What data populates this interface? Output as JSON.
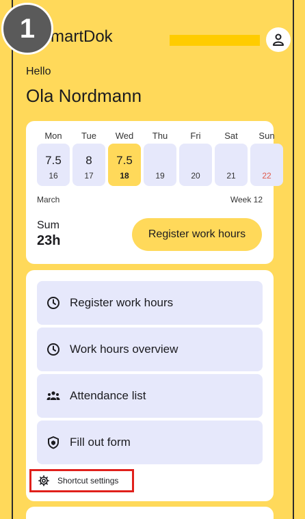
{
  "step_badge": "1",
  "app": {
    "title": "SmartDok",
    "title_visible": "martDok"
  },
  "greeting": {
    "hello": "Hello",
    "name": "Ola Nordmann"
  },
  "week": {
    "days": [
      {
        "name": "Mon",
        "hours": "7.5",
        "date": "16"
      },
      {
        "name": "Tue",
        "hours": "8",
        "date": "17"
      },
      {
        "name": "Wed",
        "hours": "7.5",
        "date": "18",
        "today": true
      },
      {
        "name": "Thu",
        "hours": "",
        "date": "19"
      },
      {
        "name": "Fri",
        "hours": "",
        "date": "20"
      },
      {
        "name": "Sat",
        "hours": "",
        "date": "21"
      },
      {
        "name": "Sun",
        "hours": "",
        "date": "22",
        "weekend": true
      }
    ],
    "month": "March",
    "week_label": "Week 12",
    "sum_label": "Sum",
    "sum_value": "23h",
    "register_button": "Register work hours"
  },
  "shortcuts": {
    "items": [
      {
        "label": "Register work hours",
        "icon": "clock-icon"
      },
      {
        "label": "Work hours overview",
        "icon": "clock-icon"
      },
      {
        "label": "Attendance list",
        "icon": "group-icon"
      },
      {
        "label": "Fill out form",
        "icon": "shield-icon"
      }
    ],
    "settings_label": "Shortcut settings"
  },
  "colors": {
    "background": "#ffd95a",
    "accent": "#ffd95a",
    "tile": "#e6e8fb",
    "highlight_border": "#e0201b",
    "weekend_text": "#e05a4c"
  }
}
